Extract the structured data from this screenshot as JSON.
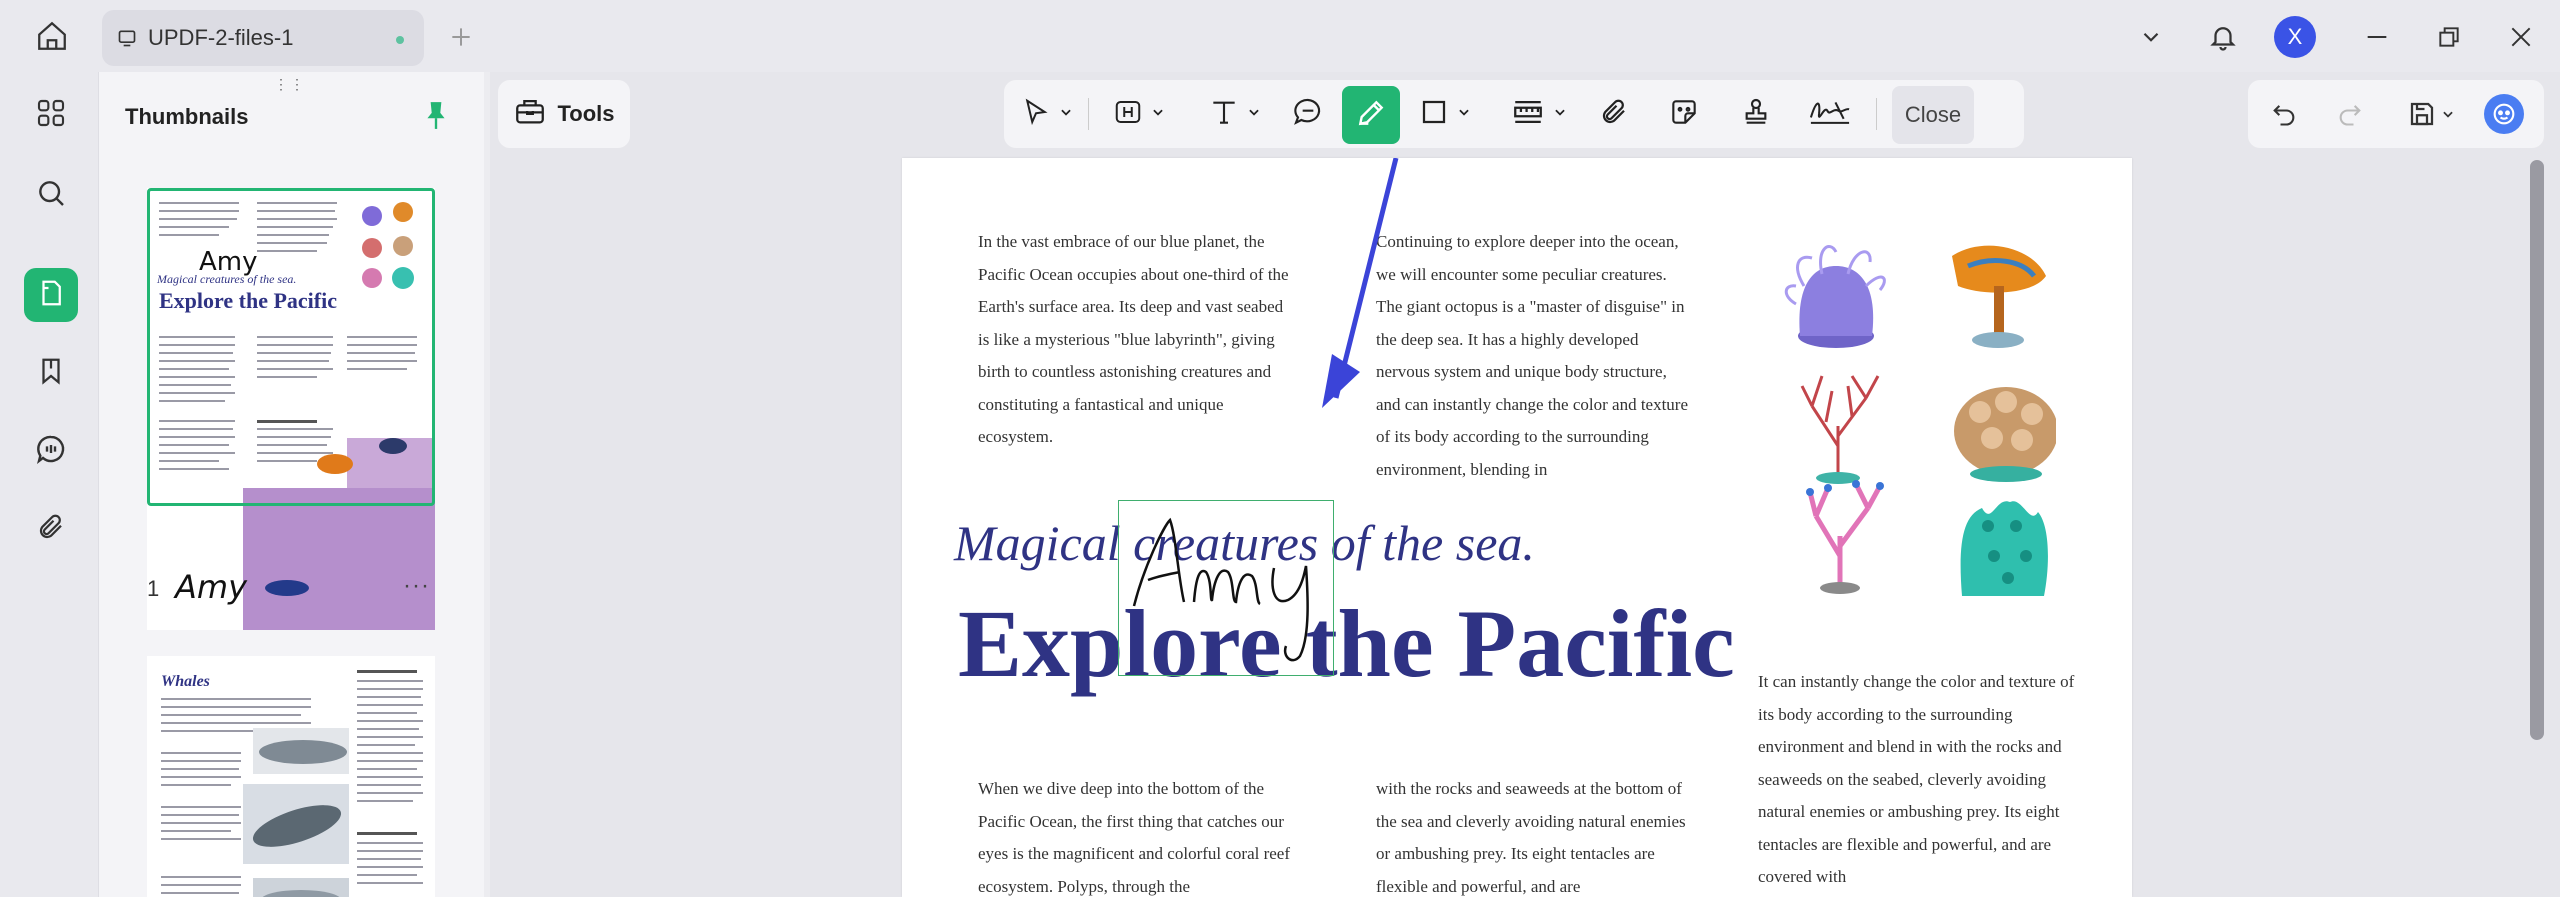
{
  "titlebar": {
    "tab_title": "UPDF-2-files-1",
    "avatar_letter": "X"
  },
  "thumbnails": {
    "title": "Thumbnails",
    "page1_number": "1",
    "more_label": "···",
    "page2_heading": "Whales"
  },
  "main": {
    "tools_label": "Tools",
    "close_label": "Close"
  },
  "document": {
    "col1_para1": "In the vast embrace of our blue planet, the Pacific Ocean occupies about one-third of the Earth's surface area. Its deep and vast seabed is like a mysterious \"blue labyrinth\", giving birth to countless astonishing creatures and constituting a fantastical and unique ecosystem.",
    "col2_para1": "Continuing to explore deeper into the ocean, we will encounter some peculiar creatures. The giant octopus is a \"master of disguise\" in the deep sea. It has a highly developed nervous system and unique body structure, and can instantly change the color and texture of its body according to the surrounding environment, blending in",
    "signature": "Amy",
    "subtitle": "Magical creatures of the sea.",
    "title": "Explore the Pacific",
    "col3_para": "It can instantly change the color and texture of its body according to the surrounding environment and blend in with the rocks and seaweeds on the seabed, cleverly avoiding natural enemies or ambushing prey. Its eight tentacles are flexible and powerful, and are covered with",
    "col1_para2": "When we dive deep into the bottom of the Pacific Ocean, the first thing that catches our eyes is the magnificent and colorful coral reef ecosystem. Polyps, through the",
    "col2_para2": "with the rocks and seaweeds at the bottom of the sea and cleverly avoiding natural enemies or ambushing prey. Its eight tentacles are flexible and powerful, and are"
  },
  "colors": {
    "accent": "#22b573",
    "title_blue": "#2f3384",
    "avatar": "#3a53e6"
  }
}
